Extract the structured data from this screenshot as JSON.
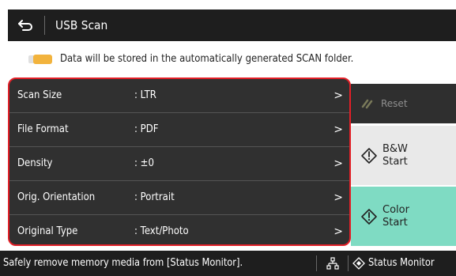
{
  "header": {
    "back_icon": "back-arrow-icon",
    "title": "USB Scan"
  },
  "info": {
    "icon": "memory-media-icon",
    "text": "Data will be stored in the automatically generated SCAN folder."
  },
  "settings": [
    {
      "label": "Scan Size",
      "value": ": LTR",
      "chevron": ">"
    },
    {
      "label": "File Format",
      "value": ": PDF",
      "chevron": ">"
    },
    {
      "label": "Density",
      "value": ": ±0",
      "chevron": ">"
    },
    {
      "label": "Orig. Orientation",
      "value": ": Portrait",
      "chevron": ">"
    },
    {
      "label": "Original Type",
      "value": ": Text/Photo",
      "chevron": ">"
    }
  ],
  "buttons": {
    "reset": {
      "label": "Reset",
      "icon": "reset-icon",
      "disabled": true
    },
    "bw_start": {
      "label": "B&W\nStart",
      "icon": "start-diamond-icon"
    },
    "color_start": {
      "label": "Color\nStart",
      "icon": "start-diamond-icon"
    }
  },
  "status_bar": {
    "message": "Safely remove memory media from [Status Monitor].",
    "network_icon": "network-icon",
    "status_monitor_icon": "status-monitor-icon",
    "status_monitor_label": "Status Monitor"
  },
  "colors": {
    "title_bar": "#1e1e1e",
    "list_bg": "#303030",
    "highlight_border": "#e21f27",
    "bw_button": "#e9e9e9",
    "color_button": "#7fdbc3",
    "memory_icon": "#f2b33d"
  }
}
